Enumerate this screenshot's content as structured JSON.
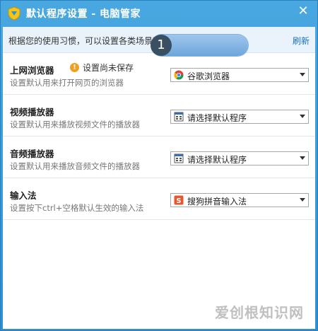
{
  "window": {
    "title": "默认程序设置 - 电脑管家",
    "close_symbol": "✕"
  },
  "infobar": {
    "text": "根据您的使用习惯，可以设置各类场景下的默认应用的程序。",
    "refresh": "刷新"
  },
  "rows": [
    {
      "title": "上网浏览器",
      "desc": "设置默认用来打开网页的浏览器",
      "warning": "设置尚未保存",
      "selected": "谷歌浏览器",
      "icon": "chrome-icon",
      "step_number": "1"
    },
    {
      "title": "视频播放器",
      "desc": "设置默认用来播放视频文件的播放器",
      "selected": "请选择默认程序",
      "icon": "app-icon"
    },
    {
      "title": "音频播放器",
      "desc": "设置默认用来播放音频文件的播放器",
      "selected": "请选择默认程序",
      "icon": "app-icon"
    },
    {
      "title": "输入法",
      "desc": "设置按下ctrl+空格默认生效的输入法",
      "selected": "搜狗拼音输入法",
      "icon": "sogou-icon"
    }
  ],
  "watermark": "爱创根知识网",
  "colors": {
    "title_bar": "#3a95d3",
    "accent": "#1a73c8",
    "warning": "#f0a020"
  }
}
